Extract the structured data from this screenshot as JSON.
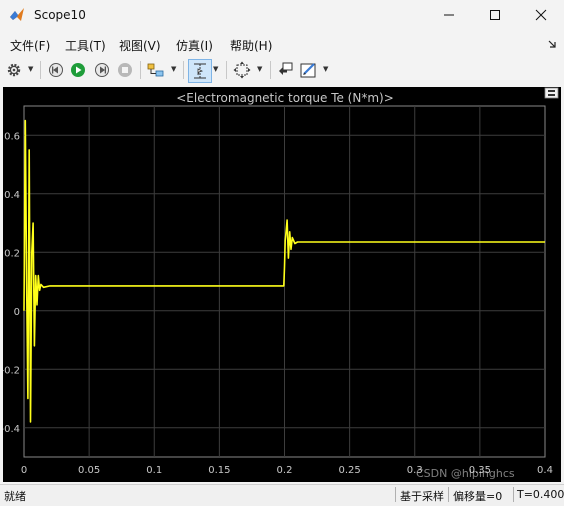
{
  "window": {
    "title": "Scope10"
  },
  "menu": [
    "文件(F)",
    "工具(T)",
    "视图(V)",
    "仿真(I)",
    "帮助(H)"
  ],
  "toolbar_icons": [
    "gear-icon",
    "step-back-icon",
    "run-icon",
    "step-forward-icon",
    "stop-icon",
    "signal-selector-icon",
    "cursor-measure-icon",
    "zoom-fit-icon",
    "highlight-block-icon",
    "style-icon"
  ],
  "colors": {
    "plot_bg": "#000000",
    "line": "#ffff1a",
    "grid": "#3d3d3d",
    "title": "#c8c8c8"
  },
  "chart_data": {
    "type": "line",
    "title": "<Electromagnetic torque Te (N*m)>",
    "xlim": [
      0,
      0.4
    ],
    "ylim": [
      -0.5,
      0.7
    ],
    "xticks": [
      "0",
      "0.05",
      "0.1",
      "0.15",
      "0.2",
      "0.25",
      "0.3",
      "0.35",
      "0.4"
    ],
    "yticks": [
      "0.6",
      "0.4",
      "0.2",
      "0",
      "-0.2",
      "-0.4"
    ],
    "grid": true,
    "series": [
      {
        "x": [
          0,
          0.001,
          0.002,
          0.003,
          0.004,
          0.005,
          0.006,
          0.007,
          0.008,
          0.009,
          0.01,
          0.011,
          0.012,
          0.013,
          0.015,
          0.02,
          0.03,
          0.05,
          0.1,
          0.15,
          0.19,
          0.1995,
          0.2,
          0.2005,
          0.201,
          0.202,
          0.203,
          0.204,
          0.205,
          0.206,
          0.208,
          0.21,
          0.25,
          0.3,
          0.35,
          0.4
        ],
        "y": [
          0,
          0.65,
          0.1,
          -0.3,
          0.55,
          -0.38,
          0.2,
          0.3,
          -0.12,
          0.12,
          0.02,
          0.12,
          0.07,
          0.09,
          0.08,
          0.085,
          0.085,
          0.085,
          0.085,
          0.085,
          0.085,
          0.085,
          0.15,
          0.24,
          0.26,
          0.31,
          0.18,
          0.27,
          0.21,
          0.25,
          0.23,
          0.235,
          0.235,
          0.235,
          0.235,
          0.235
        ]
      }
    ]
  },
  "status": {
    "left": "就绪",
    "mode": "基于采样",
    "offset": "偏移量=0",
    "time": "T=0.400"
  },
  "watermark": "CSDN @hlpinghcs"
}
